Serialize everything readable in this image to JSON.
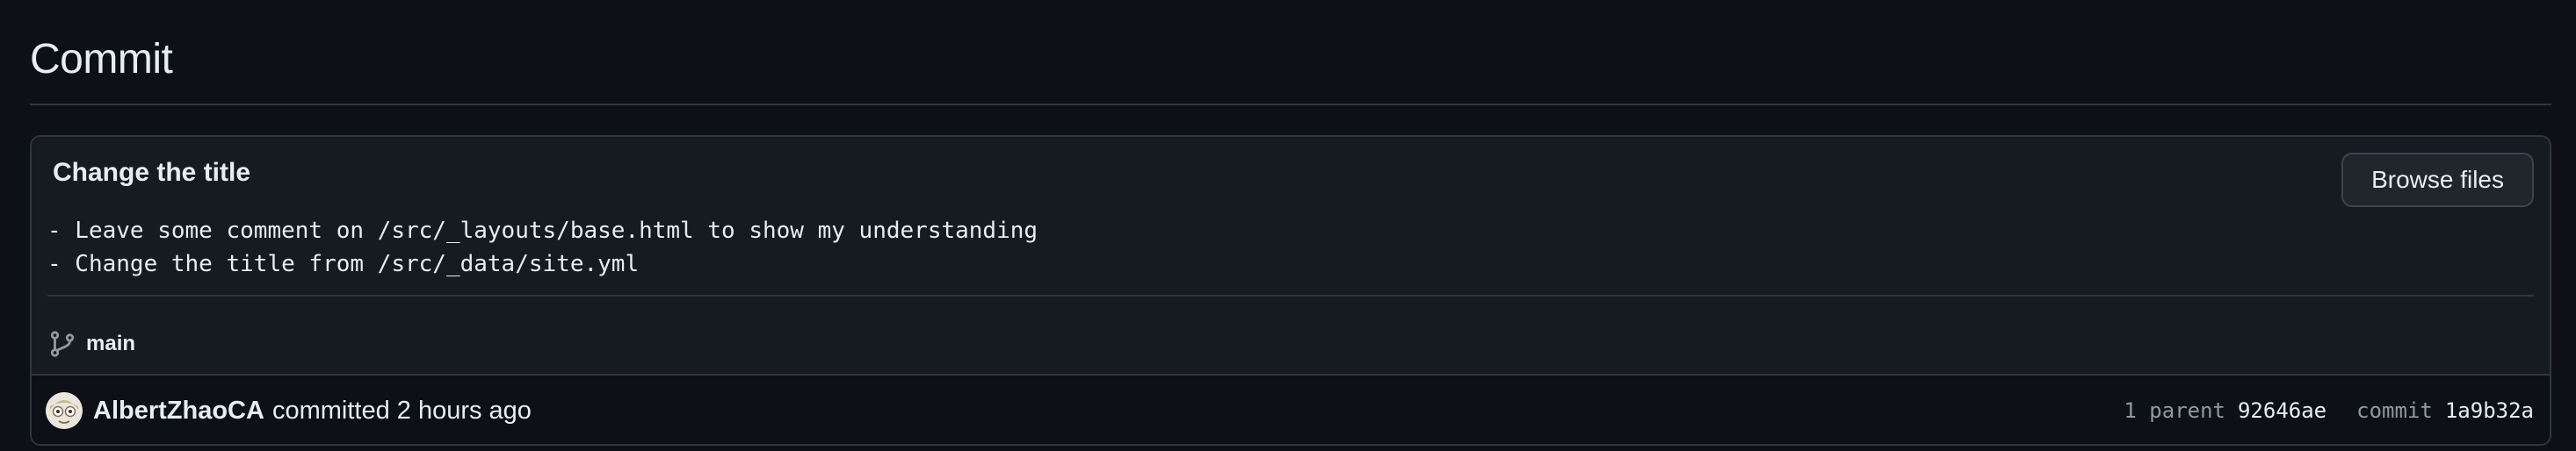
{
  "page": {
    "title": "Commit"
  },
  "commit": {
    "summary": "Change the title",
    "description_lines": [
      "- Leave some comment on /src/_layouts/base.html to show my understanding",
      "- Change the title from /src/_data/site.yml"
    ],
    "browse_files_label": "Browse files",
    "branch": "main",
    "branch_icon": "git-branch-icon",
    "author": "AlbertZhaoCA",
    "committed_text": "committed 2 hours ago",
    "parent_label": "1 parent",
    "parent_sha": "92646ae",
    "commit_label": "commit",
    "commit_sha": "1a9b32a"
  },
  "colors": {
    "background": "#0d1117",
    "panel": "#161b22",
    "border": "#30363d",
    "text": "#e6edf3",
    "muted": "#9198a1",
    "button": "#21262d"
  }
}
